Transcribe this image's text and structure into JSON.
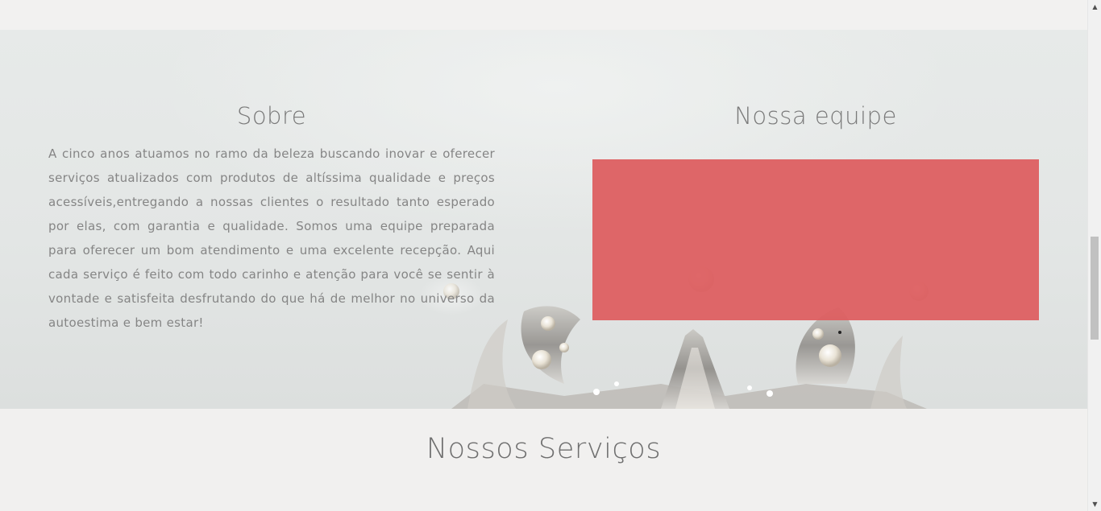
{
  "about": {
    "heading": "Sobre",
    "text": "A cinco anos atuamos no ramo da beleza buscando inovar e oferecer serviços atualizados com produtos de altíssima qualidade e preços acessíveis,entregando a nossas clientes o resultado tanto esperado por elas, com garantia e qualidade. Somos uma equipe preparada para oferecer um bom atendimento e uma excelente recepção. Aqui cada serviço é feito com todo carinho e atenção para você se sentir à vontade e satisfeita desfrutando do que há de melhor no universo da autoestima e bem estar!"
  },
  "team": {
    "heading": "Nossa equipe",
    "box_color": "#dd5e60"
  },
  "services": {
    "heading": "Nossos Serviços"
  },
  "scrollbar": {
    "up_icon": "scroll-up-arrow-icon",
    "down_icon": "scroll-down-arrow-icon",
    "up_glyph": "▲",
    "down_glyph": "▼"
  },
  "colors": {
    "page_background": "#f1f0ef",
    "text": "#7b7b7b",
    "accent": "#dd5e60"
  }
}
